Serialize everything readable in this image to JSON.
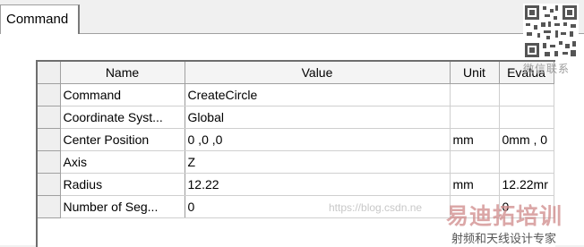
{
  "tab": {
    "label": "Command"
  },
  "columns": [
    "Name",
    "Value",
    "Unit",
    "Evalua"
  ],
  "rows": [
    {
      "name": "Command",
      "value": "CreateCircle",
      "unit": "",
      "eval": ""
    },
    {
      "name": "Coordinate Syst...",
      "value": "Global",
      "unit": "",
      "eval": ""
    },
    {
      "name": "Center Position",
      "value": "0 ,0 ,0",
      "unit": "mm",
      "eval": "0mm , 0"
    },
    {
      "name": "Axis",
      "value": "Z",
      "unit": "",
      "eval": ""
    },
    {
      "name": "Radius",
      "value": "12.22",
      "unit": "mm",
      "eval": "12.22mr"
    },
    {
      "name": "Number of Seg...",
      "value": "0",
      "unit": "",
      "eval": "0"
    }
  ],
  "overlay": {
    "qr_caption": "微信联系",
    "watermark_url": "https://blog.csdn.ne",
    "logo_text": "易迪拓培训",
    "logo_sub": "射频和天线设计专家"
  }
}
